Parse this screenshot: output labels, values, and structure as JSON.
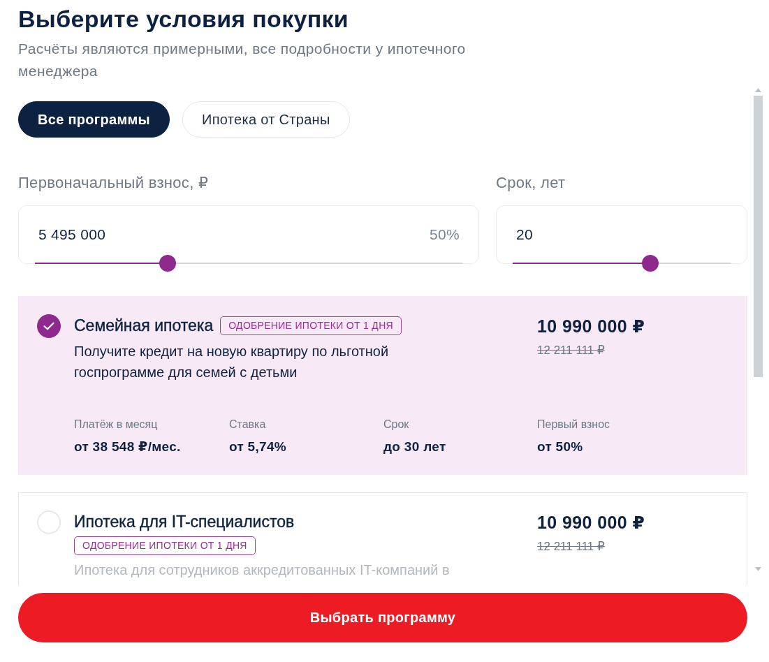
{
  "header": {
    "title": "Выберите условия покупки",
    "subtitle": "Расчёты являются примерными, все подробности у ипотечного менеджера"
  },
  "tabs": [
    {
      "label": "Все программы",
      "selected": true
    },
    {
      "label": "Ипотека от Страны",
      "selected": false
    }
  ],
  "sliders": [
    {
      "label": "Первоначальный взнос, ₽",
      "value": "5 495 000",
      "share": "50%",
      "level": 0.31
    },
    {
      "label": "Срок, лет",
      "value": "20",
      "level": 0.63
    }
  ],
  "programs": [
    {
      "title": "Семейная ипотека",
      "badge": "ОДОБРЕНИЕ ИПОТЕКИ ОТ 1 ДНЯ",
      "description": "Получите кредит на новую квартиру по льготной госпрограмме для семей с детьми",
      "price": "10 990 000 ₽",
      "old_price": "12 211 111 ₽",
      "selected": true,
      "details": [
        {
          "label": "Платёж в месяц",
          "value": "от 38 548 ₽/мес."
        },
        {
          "label": "Ставка",
          "value": "от 5,74%"
        },
        {
          "label": "Срок",
          "value": "до 30 лет"
        },
        {
          "label": "Первый взнос",
          "value": "от 50%"
        }
      ]
    },
    {
      "title": "Ипотека для IT-специалистов",
      "badge": "ОДОБРЕНИЕ ИПОТЕКИ ОТ 1 ДНЯ",
      "description": "Ипотека для сотрудников аккредитованных IT-компаний в",
      "price": "10 990 000 ₽",
      "old_price": "12 211 111 ₽",
      "selected": false
    }
  ],
  "submit_button": {
    "label": "Выбрать программу"
  }
}
